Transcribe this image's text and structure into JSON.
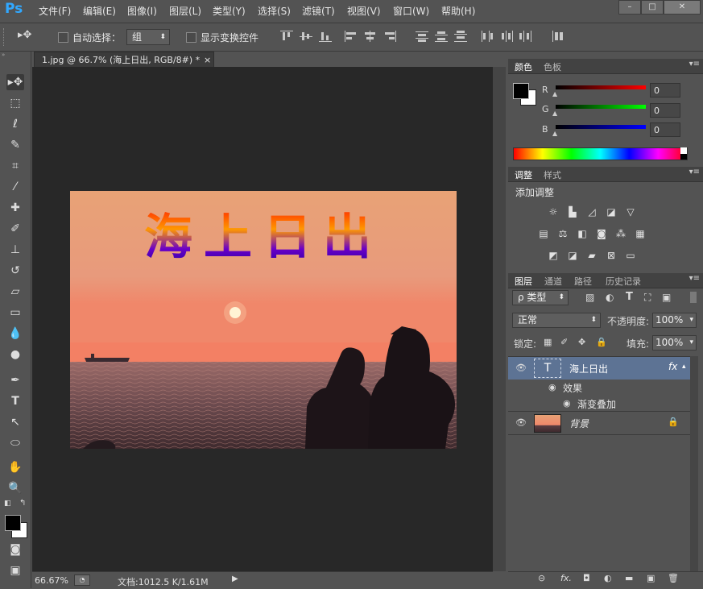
{
  "app": {
    "logo": "Ps"
  },
  "menu": [
    "文件(F)",
    "编辑(E)",
    "图像(I)",
    "图层(L)",
    "类型(Y)",
    "选择(S)",
    "滤镜(T)",
    "视图(V)",
    "窗口(W)",
    "帮助(H)"
  ],
  "window_controls": {
    "minimize": "–",
    "maximize": "□",
    "close": "✕"
  },
  "options": {
    "auto_select_label": "自动选择：",
    "auto_select_value": "组",
    "show_transform_label": "显示变换控件"
  },
  "document": {
    "tab_title": "1.jpg @ 66.7% (海上日出, RGB/8#) *",
    "tab_close": "×",
    "image_text": "海上日出",
    "zoom": "66.67%",
    "doc_info": "文档:1012.5 K/1.61M"
  },
  "color_panel": {
    "tabs": [
      "颜色",
      "色板"
    ],
    "channels": [
      {
        "label": "R",
        "value": "0",
        "color": "#d42020"
      },
      {
        "label": "G",
        "value": "0",
        "color": "#1cb01c"
      },
      {
        "label": "B",
        "value": "0",
        "color": "#2020d4"
      }
    ]
  },
  "adjustments_panel": {
    "tabs": [
      "调整",
      "样式"
    ],
    "title": "添加调整"
  },
  "layers_panel": {
    "tabs": [
      "图层",
      "通道",
      "路径",
      "历史记录"
    ],
    "filter_label": "ρ 类型",
    "blend_mode": "正常",
    "opacity_label": "不透明度:",
    "opacity_value": "100%",
    "lock_label": "锁定:",
    "fill_label": "填充:",
    "fill_value": "100%",
    "layers": [
      {
        "name": "海上日出",
        "type": "text",
        "fx": "fx",
        "thumb": "T"
      },
      {
        "name": "背景",
        "type": "image"
      }
    ],
    "effects_label": "效果",
    "effect_item": "渐变叠加",
    "bottom_buttons": [
      "⊝",
      "fx.",
      "◘",
      "◐",
      "▬",
      "▣",
      "🗑"
    ]
  },
  "colors": {
    "ui_bg": "#535353",
    "canvas_bg": "#282828",
    "selected_layer": "#5d7394",
    "text_gradient": [
      "#ff3300",
      "#ff9900",
      "#6a00c8",
      "#2a00a0"
    ]
  }
}
